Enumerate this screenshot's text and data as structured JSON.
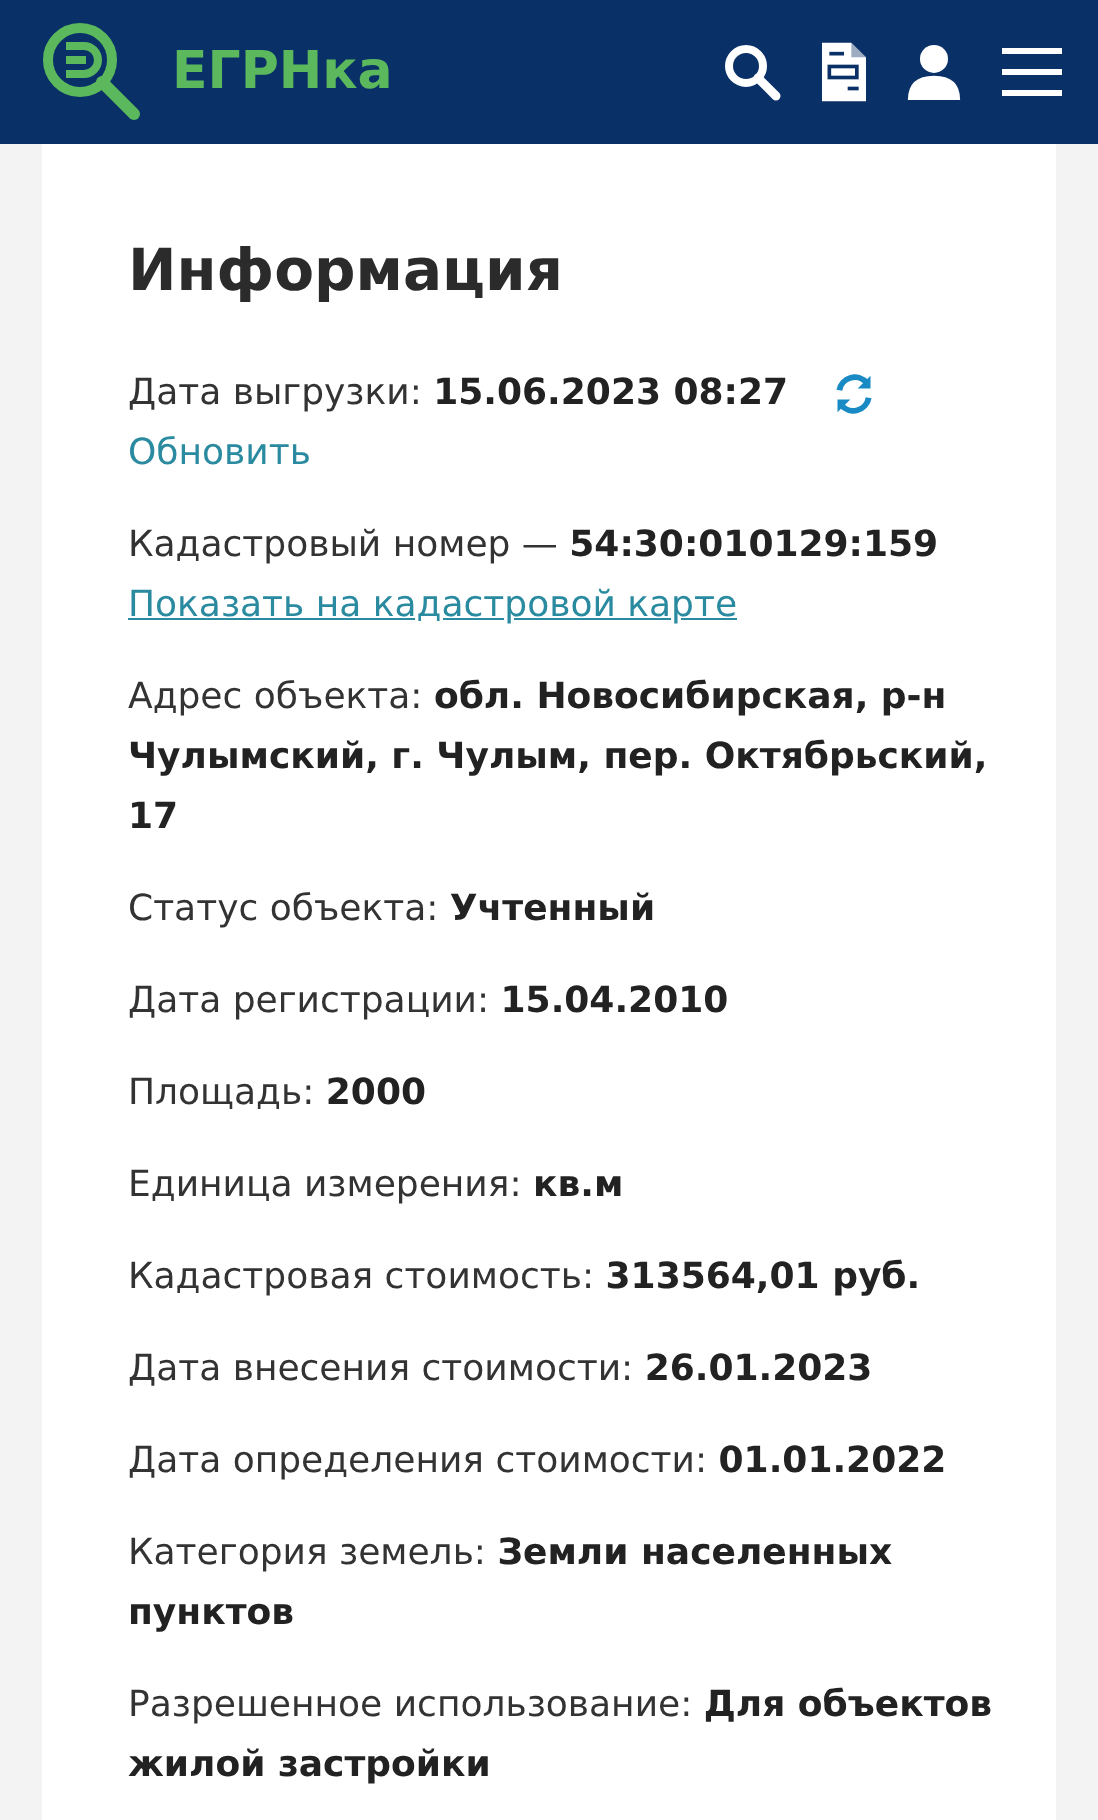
{
  "header": {
    "logo_text": "ЕГРНка"
  },
  "card": {
    "title": "Информация",
    "rows": [
      {
        "text": "Дата выгрузки: **15.06.2023 08:27**",
        "link": {
          "kind": "refresh",
          "text": "Обновить"
        }
      },
      {
        "text": "Кадастровый номер — **54:30:010129:159**",
        "link": {
          "kind": "underline",
          "text": "Показать на кадастровой карте"
        }
      },
      {
        "text": "Адрес объекта: **обл. Новосибирская, р-н Чулымский, г. Чулым, пер. Октябрьский, 17**"
      },
      {
        "text": "Статус объекта: **Учтенный**"
      },
      {
        "text": "Дата регистрации: **15.04.2010**"
      },
      {
        "text": "Площадь: **2000**"
      },
      {
        "text": "Единица измерения: **кв.м**"
      },
      {
        "text": "Кадастровая стоимость: **313564,01 руб.**"
      },
      {
        "text": "Дата внесения стоимости: **26.01.2023**"
      },
      {
        "text": "Дата определения стоимости: **01.01.2022**"
      },
      {
        "text": "Категория земель: **Земли населенных пунктов**"
      },
      {
        "text": "Разрешенное использование: **Для объектов жилой застройки**"
      }
    ]
  }
}
